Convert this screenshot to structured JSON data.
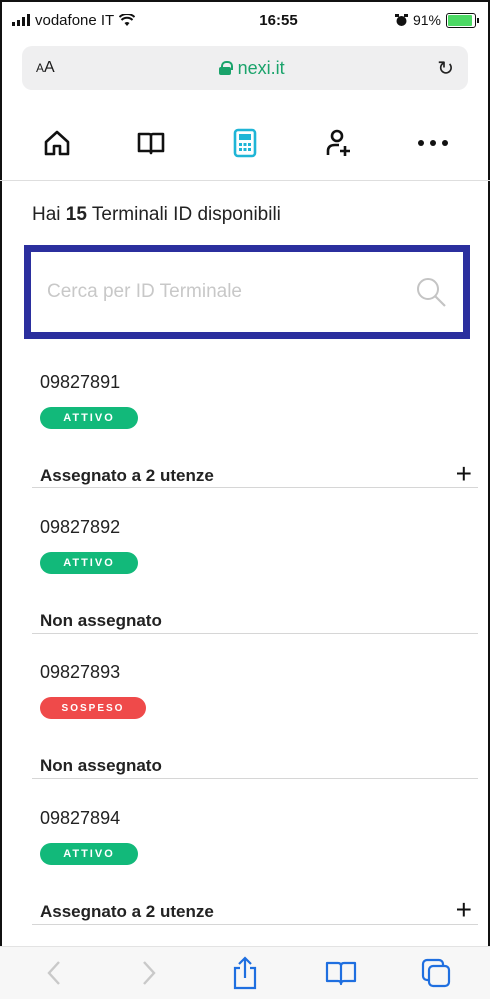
{
  "status_bar": {
    "carrier": "vodafone IT",
    "time": "16:55",
    "battery": "91%",
    "battery_level": 0.91
  },
  "browser": {
    "text_size_label": "AA",
    "url": "nexi.it"
  },
  "nav": {
    "icons": [
      "home-icon",
      "book-icon",
      "calculator-terminal-icon",
      "add-user-icon",
      "more-icon"
    ],
    "active_color": "#1fb5d6"
  },
  "heading": {
    "prefix": "Hai",
    "count": "15",
    "suffix": "Terminali ID disponibili"
  },
  "search": {
    "placeholder": "Cerca per ID Terminale",
    "value": ""
  },
  "terminals": [
    {
      "id": "09827891",
      "status": "ATTIVO",
      "assignment": "Assegnato a 2 utenze",
      "expandable": true
    },
    {
      "id": "09827892",
      "status": "ATTIVO",
      "assignment": "Non assegnato",
      "expandable": false
    },
    {
      "id": "09827893",
      "status": "SOSPESO",
      "assignment": "Non assegnato",
      "expandable": false
    },
    {
      "id": "09827894",
      "status": "ATTIVO",
      "assignment": "Assegnato a 2 utenze",
      "expandable": true
    }
  ],
  "colors": {
    "active_badge": "#12b97a",
    "suspended_badge": "#ef4a4a",
    "search_border": "#2b2f9e",
    "url_green": "#1aa36b"
  },
  "toolbar": {
    "icons": [
      "back-icon",
      "forward-icon",
      "share-icon",
      "bookmarks-icon",
      "tabs-icon"
    ]
  }
}
